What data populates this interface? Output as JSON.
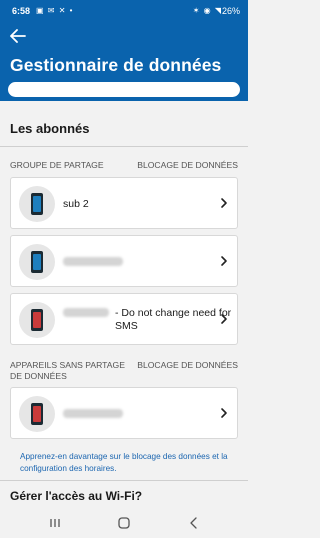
{
  "status_bar": {
    "time": "6:58",
    "left_icons": "▣ ✉ ✕ •",
    "right_icons": "✶ ◉ ◥",
    "battery": "26%"
  },
  "header": {
    "title": "Gestionnaire de données"
  },
  "subscribers": {
    "section_title": "Les abonnés",
    "sharing_group": {
      "col_left": "GROUPE DE PARTAGE",
      "col_right": "BLOCAGE DE DONNÉES",
      "items": [
        {
          "label": "sub 2"
        },
        {
          "label": ""
        },
        {
          "label": "- Do not change need for SMS"
        }
      ]
    },
    "no_sharing": {
      "col_left": "APPAREILS SANS PARTAGE DE DONNÉES",
      "col_right": "BLOCAGE DE DONNÉES",
      "items": [
        {
          "label": ""
        }
      ]
    }
  },
  "learn_more": "Apprenez-en davantage sur le blocage des données et la configuration des horaires.",
  "wifi": {
    "title": "Gérer l'accès au Wi-Fi?"
  },
  "colors": {
    "brand_blue": "#0a63ad",
    "link_blue": "#1c66b0"
  }
}
